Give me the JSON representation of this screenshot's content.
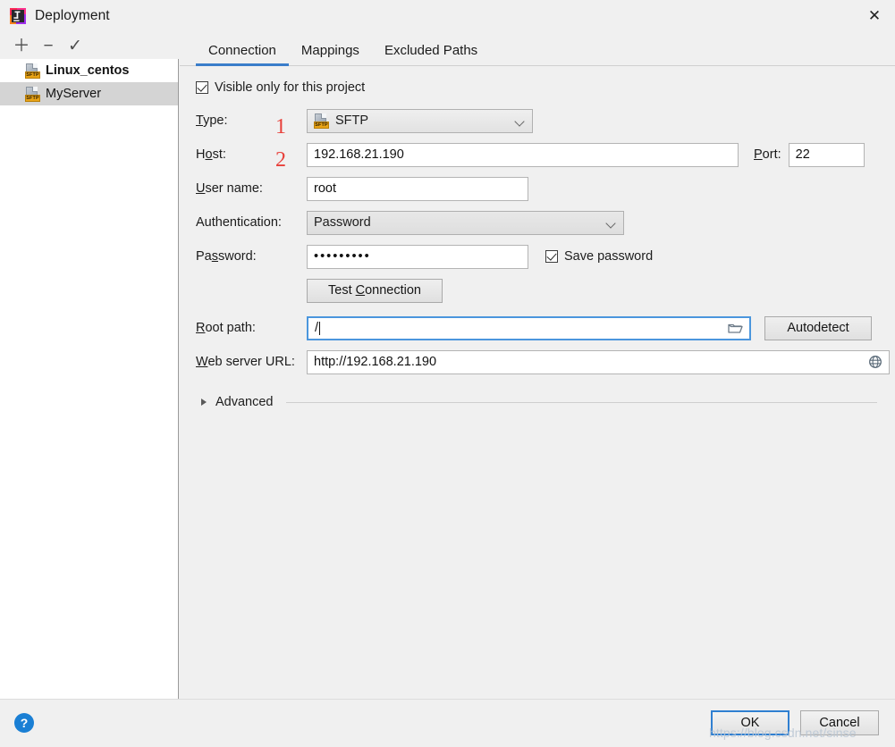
{
  "window": {
    "title": "Deployment",
    "app_icon": "intellij-idea-icon",
    "close_label": "✕"
  },
  "sidebar": {
    "toolbar": [
      {
        "name": "add",
        "glyph": "＋"
      },
      {
        "name": "remove",
        "glyph": "−"
      },
      {
        "name": "use-as-default",
        "glyph": "✓"
      }
    ],
    "items": [
      {
        "label": "Linux_centos",
        "icon": "sftp-icon",
        "icon_text": "SFTP",
        "selected": false,
        "bold": true
      },
      {
        "label": "MyServer",
        "icon": "sftp-icon",
        "icon_text": "SFTP",
        "selected": true,
        "bold": false
      }
    ]
  },
  "main": {
    "tabs": [
      {
        "label": "Connection",
        "active": true
      },
      {
        "label": "Mappings",
        "active": false
      },
      {
        "label": "Excluded Paths",
        "active": false
      }
    ],
    "visible_only_checkbox": {
      "label": "Visible only for this project",
      "checked": true
    },
    "fields": {
      "type_label": "Type:",
      "type_value": "SFTP",
      "type_icon_text": "SFTP",
      "host_label": "Host:",
      "host_value": "192.168.21.190",
      "port_label": "Port:",
      "port_value": "22",
      "username_label": "User name:",
      "username_value": "root",
      "auth_label": "Authentication:",
      "auth_value": "Password",
      "password_label": "Password:",
      "password_value": "•••••••••",
      "save_password_label": "Save password",
      "save_password_checked": true,
      "test_connection_label": "Test Connection",
      "root_path_label": "Root path:",
      "root_path_value": "/",
      "root_path_browse_icon": "folder-icon",
      "autodetect_label": "Autodetect",
      "web_server_url_label": "Web server URL:",
      "web_server_url_value": "http://192.168.21.190",
      "web_server_url_icon": "globe-icon"
    },
    "advanced": {
      "label": "Advanced",
      "expanded": false
    },
    "annotations": [
      {
        "text": "1",
        "color": "#e8403a"
      },
      {
        "text": "2",
        "color": "#e8403a"
      }
    ]
  },
  "footer": {
    "help_label": "?",
    "ok_label": "OK",
    "cancel_label": "Cancel",
    "watermark": "https://blog.csdn.net/sinse"
  }
}
